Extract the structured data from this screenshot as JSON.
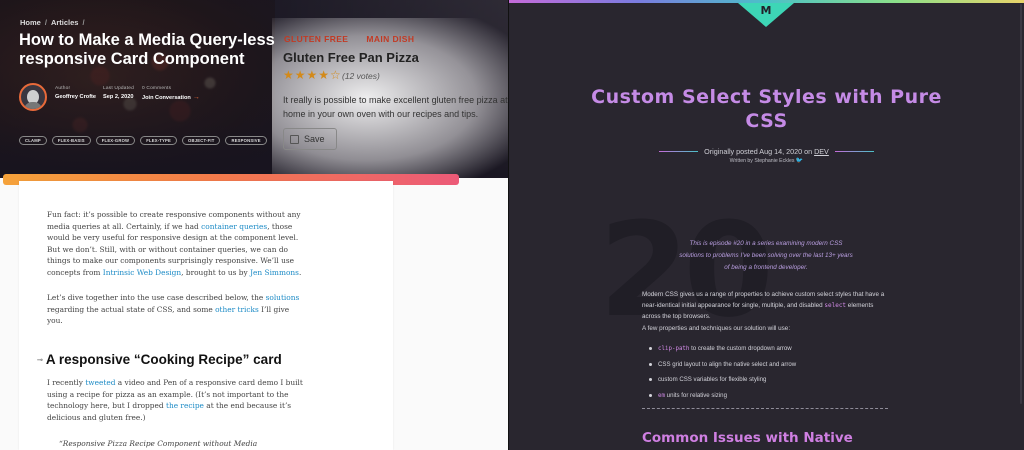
{
  "left": {
    "breadcrumb": [
      "Home",
      "Articles"
    ],
    "breadcrumb_sep": "/",
    "article_title": "How to Make a Media Query-less responsive Card Component",
    "meta": [
      {
        "key": "Author",
        "value": "Geoffrey Crofte"
      },
      {
        "key": "Last Updated",
        "value": "Sep 2, 2020"
      },
      {
        "key": "0 Comments",
        "value": "Join Conversation"
      }
    ],
    "join_arrow": "→",
    "tags": [
      "CLAMP",
      "FLEX-BASIS",
      "FLEX-GROW",
      "FLEX-TYPE",
      "OBJECT-FIT",
      "RESPONSIVE"
    ],
    "preview_card": {
      "tags": [
        "GLUTEN FREE",
        "MAIN DISH"
      ],
      "title": "Gluten Free Pan Pizza",
      "stars": "★★★★☆",
      "rating": 4,
      "votes": "(12 votes)",
      "description": "It really is possible to make excellent gluten free pizza at home in your own oven with our recipes and tips.",
      "save_label": "Save"
    },
    "p1": {
      "t1": "Fun fact: it’s possible to create responsive components without any media queries at all. Certainly, if we had ",
      "l1": "container queries",
      "t2": ", those would be very useful for responsive design at the component level. But we don’t. Still, with or without container queries, we can do things to make our components surprisingly responsive. We’ll use concepts from ",
      "l2": "Intrinsic Web Design",
      "t3": ", brought to us by ",
      "l3": "Jen Simmons",
      "t4": "."
    },
    "p2": {
      "t1": "Let’s dive together into the use case described below, the ",
      "l1": "solutions",
      "t2": " regarding the actual state of CSS, and some ",
      "l2": "other tricks",
      "t3": " I’ll give you."
    },
    "section_heading": "A responsive “Cooking Recipe” card",
    "p3": {
      "t1": "I recently ",
      "l1": "tweeted",
      "t2": " a video and Pen of a responsive card demo I built using a recipe for pizza as an example. (It’s not important to the technology here, but I dropped ",
      "l2": "the recipe",
      "t3": " at the end because it’s delicious and gluten free.)"
    },
    "quote": "“Responsive Pizza Recipe Component without Media"
  },
  "right": {
    "logo_letter": "M",
    "title": "Custom Select Styles with Pure CSS",
    "byline_prefix": "Originally posted Aug 14, 2020 on ",
    "byline_link": "DEV",
    "written_by": "Written by Stephanie Eckles",
    "episode_number": "20",
    "episode_note": "This is episode #20 in a series examining modern CSS solutions to problems I've been solving over the last 13+ years of being a frontend developer.",
    "intro_t1": "Modern CSS gives us a range of properties to achieve custom select styles that have a near-identical initial appearance for single, multiple, and disabled ",
    "intro_code": "select",
    "intro_t2": " elements across the top browsers.",
    "props_lead": "A few properties and techniques our solution will use:",
    "props": [
      {
        "code": "clip-path",
        "text": " to create the custom dropdown arrow"
      },
      {
        "code": "",
        "text": "CSS grid layout to align the native select and arrow"
      },
      {
        "code": "",
        "text": "custom CSS variables for flexible styling"
      },
      {
        "code": "em",
        "text": " units for relative sizing"
      }
    ],
    "section2": "Common Issues with Native"
  },
  "colors": {
    "accent_orange": "#f37c4a",
    "accent_pink": "#ec5a78",
    "link_blue": "#1d8bc6",
    "title_purple": "#c58be6",
    "logo_teal": "#3dd6b6",
    "code_pink": "#d18ae6"
  }
}
